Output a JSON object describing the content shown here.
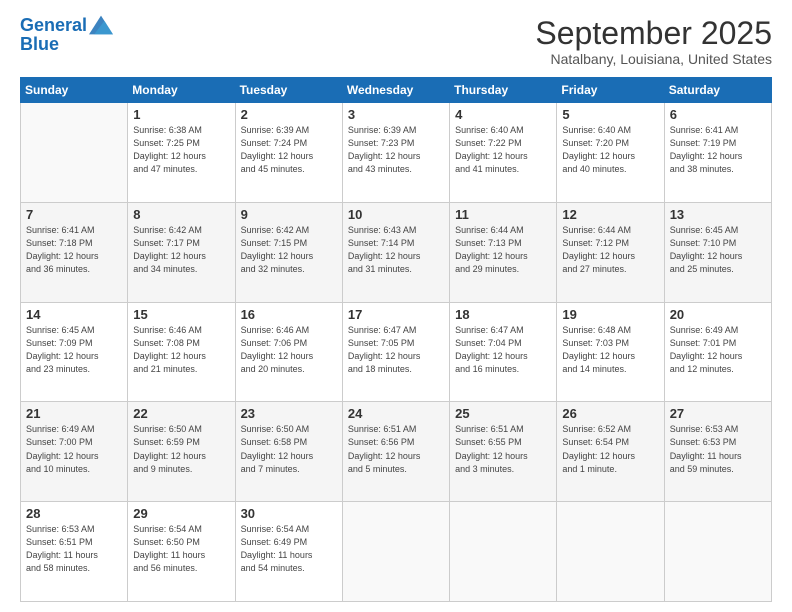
{
  "logo": {
    "line1": "General",
    "line2": "Blue"
  },
  "title": "September 2025",
  "subtitle": "Natalbany, Louisiana, United States",
  "days_header": [
    "Sunday",
    "Monday",
    "Tuesday",
    "Wednesday",
    "Thursday",
    "Friday",
    "Saturday"
  ],
  "weeks": [
    [
      {
        "num": "",
        "info": ""
      },
      {
        "num": "1",
        "info": "Sunrise: 6:38 AM\nSunset: 7:25 PM\nDaylight: 12 hours\nand 47 minutes."
      },
      {
        "num": "2",
        "info": "Sunrise: 6:39 AM\nSunset: 7:24 PM\nDaylight: 12 hours\nand 45 minutes."
      },
      {
        "num": "3",
        "info": "Sunrise: 6:39 AM\nSunset: 7:23 PM\nDaylight: 12 hours\nand 43 minutes."
      },
      {
        "num": "4",
        "info": "Sunrise: 6:40 AM\nSunset: 7:22 PM\nDaylight: 12 hours\nand 41 minutes."
      },
      {
        "num": "5",
        "info": "Sunrise: 6:40 AM\nSunset: 7:20 PM\nDaylight: 12 hours\nand 40 minutes."
      },
      {
        "num": "6",
        "info": "Sunrise: 6:41 AM\nSunset: 7:19 PM\nDaylight: 12 hours\nand 38 minutes."
      }
    ],
    [
      {
        "num": "7",
        "info": "Sunrise: 6:41 AM\nSunset: 7:18 PM\nDaylight: 12 hours\nand 36 minutes."
      },
      {
        "num": "8",
        "info": "Sunrise: 6:42 AM\nSunset: 7:17 PM\nDaylight: 12 hours\nand 34 minutes."
      },
      {
        "num": "9",
        "info": "Sunrise: 6:42 AM\nSunset: 7:15 PM\nDaylight: 12 hours\nand 32 minutes."
      },
      {
        "num": "10",
        "info": "Sunrise: 6:43 AM\nSunset: 7:14 PM\nDaylight: 12 hours\nand 31 minutes."
      },
      {
        "num": "11",
        "info": "Sunrise: 6:44 AM\nSunset: 7:13 PM\nDaylight: 12 hours\nand 29 minutes."
      },
      {
        "num": "12",
        "info": "Sunrise: 6:44 AM\nSunset: 7:12 PM\nDaylight: 12 hours\nand 27 minutes."
      },
      {
        "num": "13",
        "info": "Sunrise: 6:45 AM\nSunset: 7:10 PM\nDaylight: 12 hours\nand 25 minutes."
      }
    ],
    [
      {
        "num": "14",
        "info": "Sunrise: 6:45 AM\nSunset: 7:09 PM\nDaylight: 12 hours\nand 23 minutes."
      },
      {
        "num": "15",
        "info": "Sunrise: 6:46 AM\nSunset: 7:08 PM\nDaylight: 12 hours\nand 21 minutes."
      },
      {
        "num": "16",
        "info": "Sunrise: 6:46 AM\nSunset: 7:06 PM\nDaylight: 12 hours\nand 20 minutes."
      },
      {
        "num": "17",
        "info": "Sunrise: 6:47 AM\nSunset: 7:05 PM\nDaylight: 12 hours\nand 18 minutes."
      },
      {
        "num": "18",
        "info": "Sunrise: 6:47 AM\nSunset: 7:04 PM\nDaylight: 12 hours\nand 16 minutes."
      },
      {
        "num": "19",
        "info": "Sunrise: 6:48 AM\nSunset: 7:03 PM\nDaylight: 12 hours\nand 14 minutes."
      },
      {
        "num": "20",
        "info": "Sunrise: 6:49 AM\nSunset: 7:01 PM\nDaylight: 12 hours\nand 12 minutes."
      }
    ],
    [
      {
        "num": "21",
        "info": "Sunrise: 6:49 AM\nSunset: 7:00 PM\nDaylight: 12 hours\nand 10 minutes."
      },
      {
        "num": "22",
        "info": "Sunrise: 6:50 AM\nSunset: 6:59 PM\nDaylight: 12 hours\nand 9 minutes."
      },
      {
        "num": "23",
        "info": "Sunrise: 6:50 AM\nSunset: 6:58 PM\nDaylight: 12 hours\nand 7 minutes."
      },
      {
        "num": "24",
        "info": "Sunrise: 6:51 AM\nSunset: 6:56 PM\nDaylight: 12 hours\nand 5 minutes."
      },
      {
        "num": "25",
        "info": "Sunrise: 6:51 AM\nSunset: 6:55 PM\nDaylight: 12 hours\nand 3 minutes."
      },
      {
        "num": "26",
        "info": "Sunrise: 6:52 AM\nSunset: 6:54 PM\nDaylight: 12 hours\nand 1 minute."
      },
      {
        "num": "27",
        "info": "Sunrise: 6:53 AM\nSunset: 6:53 PM\nDaylight: 11 hours\nand 59 minutes."
      }
    ],
    [
      {
        "num": "28",
        "info": "Sunrise: 6:53 AM\nSunset: 6:51 PM\nDaylight: 11 hours\nand 58 minutes."
      },
      {
        "num": "29",
        "info": "Sunrise: 6:54 AM\nSunset: 6:50 PM\nDaylight: 11 hours\nand 56 minutes."
      },
      {
        "num": "30",
        "info": "Sunrise: 6:54 AM\nSunset: 6:49 PM\nDaylight: 11 hours\nand 54 minutes."
      },
      {
        "num": "",
        "info": ""
      },
      {
        "num": "",
        "info": ""
      },
      {
        "num": "",
        "info": ""
      },
      {
        "num": "",
        "info": ""
      }
    ]
  ]
}
